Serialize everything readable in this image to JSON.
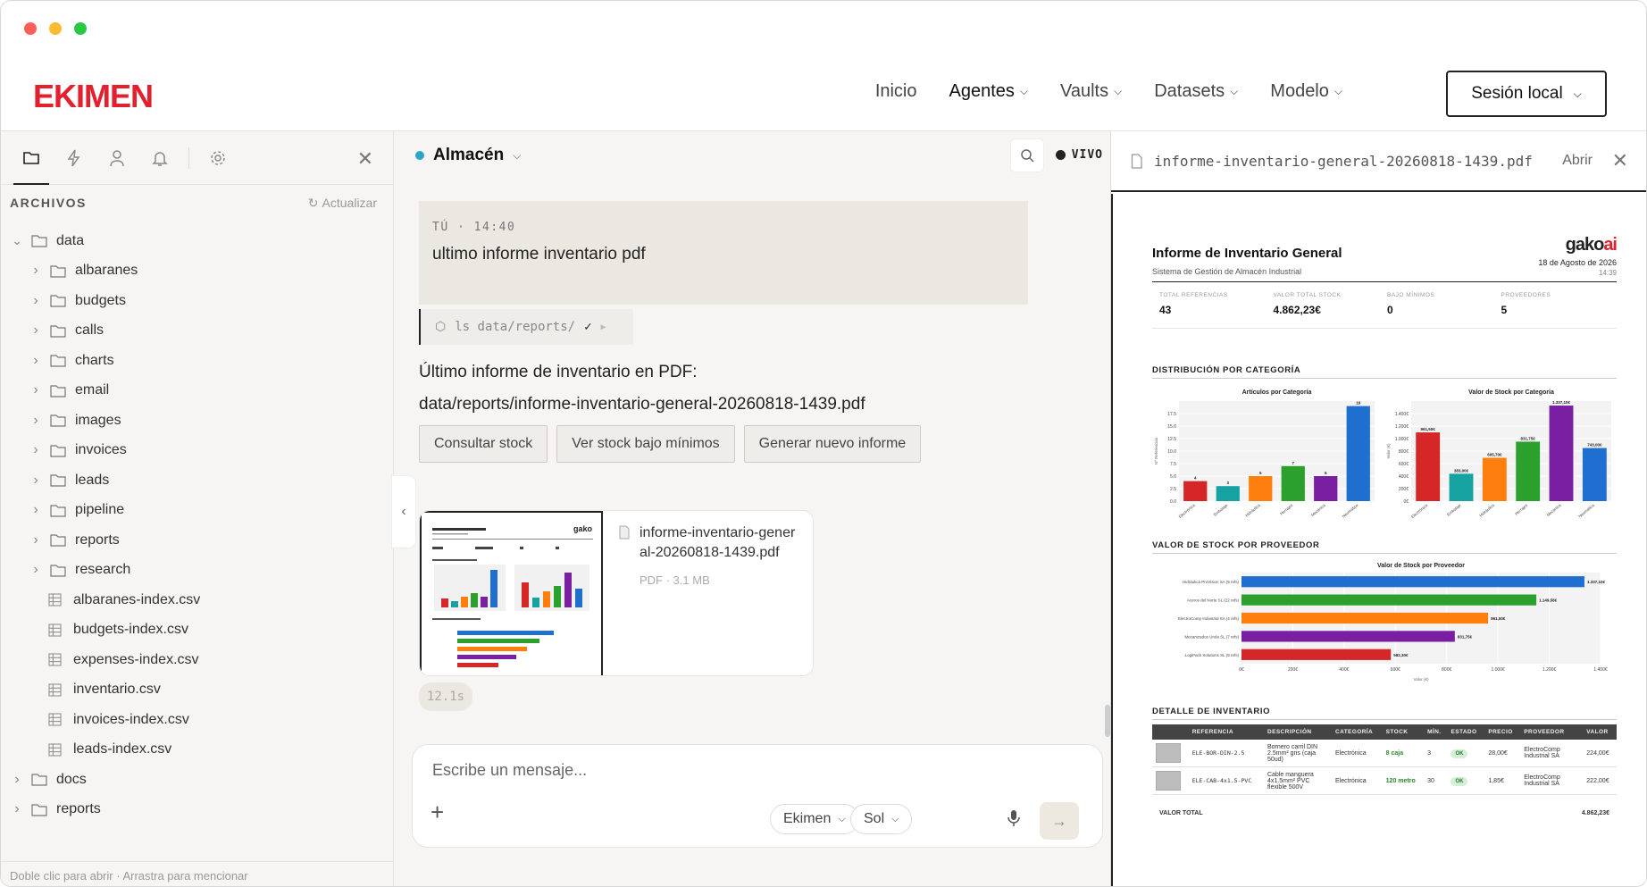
{
  "header": {
    "logo": "EKIMEN",
    "nav": [
      {
        "label": "Inicio",
        "has_menu": false
      },
      {
        "label": "Agentes",
        "has_menu": true
      },
      {
        "label": "Vaults",
        "has_menu": true
      },
      {
        "label": "Datasets",
        "has_menu": true
      },
      {
        "label": "Modelo",
        "has_menu": true
      }
    ],
    "session_label": "Sesión local"
  },
  "sidebar": {
    "tabs": [
      "folder-icon",
      "bolt-icon",
      "user-icon",
      "bell-icon",
      "gear-icon"
    ],
    "title": "ARCHIVOS",
    "refresh_label": "Actualizar",
    "tree": [
      {
        "name": "data",
        "type": "folder",
        "level": 0,
        "expanded": true
      },
      {
        "name": "albaranes",
        "type": "folder",
        "level": 1
      },
      {
        "name": "budgets",
        "type": "folder",
        "level": 1
      },
      {
        "name": "calls",
        "type": "folder",
        "level": 1
      },
      {
        "name": "charts",
        "type": "folder",
        "level": 1
      },
      {
        "name": "email",
        "type": "folder",
        "level": 1
      },
      {
        "name": "images",
        "type": "folder",
        "level": 1
      },
      {
        "name": "invoices",
        "type": "folder",
        "level": 1
      },
      {
        "name": "leads",
        "type": "folder",
        "level": 1
      },
      {
        "name": "pipeline",
        "type": "folder",
        "level": 1
      },
      {
        "name": "reports",
        "type": "folder",
        "level": 1
      },
      {
        "name": "research",
        "type": "folder",
        "level": 1
      },
      {
        "name": "albaranes-index.csv",
        "type": "file",
        "level": 1
      },
      {
        "name": "budgets-index.csv",
        "type": "file",
        "level": 1
      },
      {
        "name": "expenses-index.csv",
        "type": "file",
        "level": 1
      },
      {
        "name": "inventario.csv",
        "type": "file",
        "level": 1
      },
      {
        "name": "invoices-index.csv",
        "type": "file",
        "level": 1
      },
      {
        "name": "leads-index.csv",
        "type": "file",
        "level": 1
      },
      {
        "name": "docs",
        "type": "folder",
        "level": 0
      },
      {
        "name": "reports",
        "type": "folder",
        "level": 0
      }
    ],
    "footer": "Doble clic para abrir · Arrastra para mencionar"
  },
  "chat": {
    "agent": "Almacén",
    "live_label": "VIVO",
    "user_meta": "TÚ · 14:40",
    "user_text": "ultimo informe inventario pdf",
    "tool_call": "ls data/reports/",
    "tool_status": "✓",
    "assistant_line1": "Último informe de inventario en PDF:",
    "assistant_line2": "data/reports/informe-inventario-general-20260818-1439.pdf",
    "quick_actions": [
      "Consultar stock",
      "Ver stock bajo mínimos",
      "Generar nuevo informe"
    ],
    "attachment": {
      "name": "informe-inventario-general-20260818-1439.pdf",
      "meta": "PDF · 3.1 MB"
    },
    "timing": "12.1s",
    "composer_placeholder": "Escribe un mensaje...",
    "agent_pill": "Ekimen",
    "model_pill": "Sol"
  },
  "preview": {
    "filename": "informe-inventario-general-20260818-1439.pdf",
    "open_label": "Abrir",
    "doc": {
      "title": "Informe de Inventario General",
      "subtitle": "Sistema de Gestión de Almacén Industrial",
      "brand": "gako",
      "brand_ai": "ai",
      "date": "18 de Agosto de 2026",
      "time": "14:39",
      "kpis": [
        {
          "label": "TOTAL REFERENCIAS",
          "value": "43"
        },
        {
          "label": "VALOR TOTAL STOCK",
          "value": "4.862,23€"
        },
        {
          "label": "BAJO MÍNIMOS",
          "value": "0"
        },
        {
          "label": "PROVEEDORES",
          "value": "5"
        }
      ],
      "section_category": "DISTRIBUCIÓN POR CATEGORÍA",
      "section_supplier": "VALOR DE STOCK POR PROVEEDOR",
      "section_detail": "DETALLE DE INVENTARIO",
      "table_headers": [
        "",
        "REFERENCIA",
        "DESCRIPCIÓN",
        "CATEGORÍA",
        "STOCK",
        "MÍN.",
        "ESTADO",
        "PRECIO",
        "PROVEEDOR",
        "VALOR"
      ],
      "table_rows": [
        [
          "",
          "ELE-BOR-DIN-2.5",
          "Bornero carril DIN 2.5mm² gris (caja 50ud)",
          "Electrónica",
          "8 caja",
          "3",
          "OK",
          "28,00€",
          "ElectroComp Industrial SA",
          "224,00€"
        ],
        [
          "",
          "ELE-CAB-4x1.5-PVC",
          "Cable manguera 4x1.5mm² PVC flexible 500V",
          "Electrónica",
          "120 metro",
          "30",
          "OK",
          "1,85€",
          "ElectroComp Industrial SA",
          "222,00€"
        ]
      ],
      "total_label": "VALOR TOTAL",
      "total_value": "4.862,23€"
    }
  },
  "chart_data": [
    {
      "type": "bar",
      "title": "Artículos por Categoría",
      "ylabel": "Nº Referencias",
      "categories": [
        "Electrónica",
        "Embalaje",
        "Hidráulica",
        "Herrajes",
        "Mecánica",
        "Neumática"
      ],
      "values": [
        4,
        3,
        5,
        7,
        5,
        19
      ],
      "colors": [
        "#d62728",
        "#17a2a2",
        "#ff7f0e",
        "#2ca02c",
        "#7b1fa2",
        "#1f6fd1"
      ],
      "ylim": [
        0,
        20
      ],
      "ticks": [
        "0.0",
        "2.5",
        "5.0",
        "7.5",
        "10.0",
        "12.5",
        "15.0",
        "17.5"
      ]
    },
    {
      "type": "bar",
      "title": "Valor de Stock por Categoría",
      "ylabel": "Valor (€)",
      "categories": [
        "Electrónica",
        "Embalaje",
        "Hidráulica",
        "Herrajes",
        "Mecánica",
        "Neumática"
      ],
      "values": [
        961.5,
        383.0,
        605.7,
        831.75,
        1337.1,
        743.0
      ],
      "labels": [
        "961,50€",
        "383,00€",
        "605,70€",
        "831,75€",
        "1.337,10€",
        "743,00€"
      ],
      "colors": [
        "#d62728",
        "#17a2a2",
        "#ff7f0e",
        "#2ca02c",
        "#7b1fa2",
        "#1f6fd1"
      ],
      "ylim": [
        0,
        1400
      ],
      "ticks": [
        "0€",
        "200€",
        "400€",
        "600€",
        "800€",
        "1.000€",
        "1.200€",
        "1.400€"
      ]
    },
    {
      "type": "bar",
      "orientation": "horizontal",
      "title": "Valor de Stock por Proveedor",
      "xlabel": "Valor (€)",
      "categories": [
        "Hidráulica ProVision SA (5 refs)",
        "Aceros del Norte SL (22 refs)",
        "ElectroComp Industrial SA (4 refs)",
        "Mecanizados Urola SL (7 refs)",
        "LogiPack Solutions SL (5 refs)"
      ],
      "values": [
        1337.1,
        1149.58,
        961.5,
        831.75,
        582.3
      ],
      "labels": [
        "1.337,10€",
        "1.149,58€",
        "961,50€",
        "831,75€",
        "582,30€"
      ],
      "colors": [
        "#1f6fd1",
        "#2ca02c",
        "#ff7f0e",
        "#7b1fa2",
        "#d62728"
      ],
      "xlim": [
        0,
        1400
      ],
      "ticks": [
        "0€",
        "200€",
        "400€",
        "600€",
        "800€",
        "1.000€",
        "1.200€",
        "1.400€"
      ]
    }
  ]
}
